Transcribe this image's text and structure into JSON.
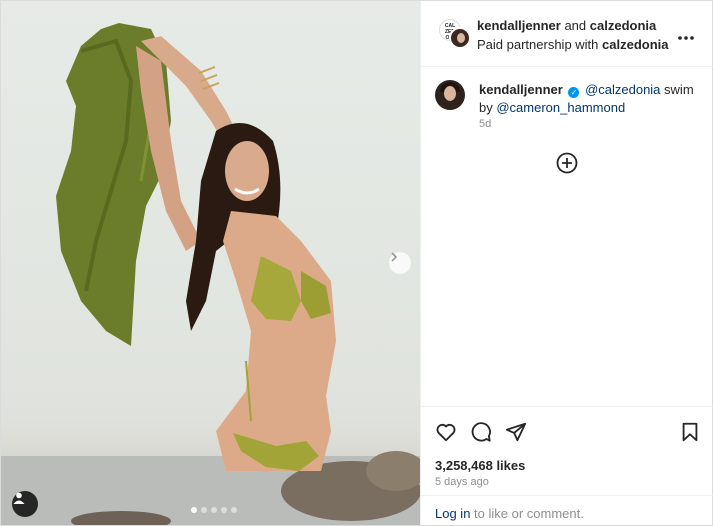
{
  "header": {
    "account1": "kendalljenner",
    "conjunction": "and",
    "account2": "calzedonia",
    "partnership_prefix": "Paid partnership with",
    "partner": "calzedonia",
    "logo_text": "CAL ZED ONI"
  },
  "caption": {
    "username": "kendalljenner",
    "mention1": "@calzedonia",
    "text1": "swim",
    "by": "by",
    "mention2": "@cameron_hammond",
    "time": "5d"
  },
  "actions": {
    "likes": "3,258,468 likes",
    "ago": "5 days ago",
    "login_link": "Log in",
    "login_rest": "to like or comment."
  },
  "media": {
    "carousel_count": 5,
    "carousel_active": 0
  },
  "colors": {
    "link": "#00376b",
    "verified": "#0095f6",
    "muted": "#8e8e8e",
    "text": "#262626"
  },
  "icons": [
    "more-icon",
    "verified-icon",
    "add-comment-icon",
    "heart-icon",
    "comment-icon",
    "share-icon",
    "bookmark-icon",
    "next-arrow-icon",
    "user-tag-icon"
  ]
}
